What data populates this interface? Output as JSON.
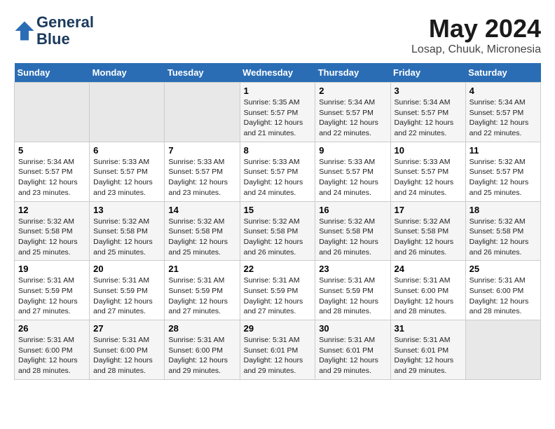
{
  "header": {
    "logo_line1": "General",
    "logo_line2": "Blue",
    "title": "May 2024",
    "subtitle": "Losap, Chuuk, Micronesia"
  },
  "weekdays": [
    "Sunday",
    "Monday",
    "Tuesday",
    "Wednesday",
    "Thursday",
    "Friday",
    "Saturday"
  ],
  "weeks": [
    [
      {
        "day": "",
        "info": ""
      },
      {
        "day": "",
        "info": ""
      },
      {
        "day": "",
        "info": ""
      },
      {
        "day": "1",
        "info": "Sunrise: 5:35 AM\nSunset: 5:57 PM\nDaylight: 12 hours and 21 minutes."
      },
      {
        "day": "2",
        "info": "Sunrise: 5:34 AM\nSunset: 5:57 PM\nDaylight: 12 hours and 22 minutes."
      },
      {
        "day": "3",
        "info": "Sunrise: 5:34 AM\nSunset: 5:57 PM\nDaylight: 12 hours and 22 minutes."
      },
      {
        "day": "4",
        "info": "Sunrise: 5:34 AM\nSunset: 5:57 PM\nDaylight: 12 hours and 22 minutes."
      }
    ],
    [
      {
        "day": "5",
        "info": "Sunrise: 5:34 AM\nSunset: 5:57 PM\nDaylight: 12 hours and 23 minutes."
      },
      {
        "day": "6",
        "info": "Sunrise: 5:33 AM\nSunset: 5:57 PM\nDaylight: 12 hours and 23 minutes."
      },
      {
        "day": "7",
        "info": "Sunrise: 5:33 AM\nSunset: 5:57 PM\nDaylight: 12 hours and 23 minutes."
      },
      {
        "day": "8",
        "info": "Sunrise: 5:33 AM\nSunset: 5:57 PM\nDaylight: 12 hours and 24 minutes."
      },
      {
        "day": "9",
        "info": "Sunrise: 5:33 AM\nSunset: 5:57 PM\nDaylight: 12 hours and 24 minutes."
      },
      {
        "day": "10",
        "info": "Sunrise: 5:33 AM\nSunset: 5:57 PM\nDaylight: 12 hours and 24 minutes."
      },
      {
        "day": "11",
        "info": "Sunrise: 5:32 AM\nSunset: 5:57 PM\nDaylight: 12 hours and 25 minutes."
      }
    ],
    [
      {
        "day": "12",
        "info": "Sunrise: 5:32 AM\nSunset: 5:58 PM\nDaylight: 12 hours and 25 minutes."
      },
      {
        "day": "13",
        "info": "Sunrise: 5:32 AM\nSunset: 5:58 PM\nDaylight: 12 hours and 25 minutes."
      },
      {
        "day": "14",
        "info": "Sunrise: 5:32 AM\nSunset: 5:58 PM\nDaylight: 12 hours and 25 minutes."
      },
      {
        "day": "15",
        "info": "Sunrise: 5:32 AM\nSunset: 5:58 PM\nDaylight: 12 hours and 26 minutes."
      },
      {
        "day": "16",
        "info": "Sunrise: 5:32 AM\nSunset: 5:58 PM\nDaylight: 12 hours and 26 minutes."
      },
      {
        "day": "17",
        "info": "Sunrise: 5:32 AM\nSunset: 5:58 PM\nDaylight: 12 hours and 26 minutes."
      },
      {
        "day": "18",
        "info": "Sunrise: 5:32 AM\nSunset: 5:58 PM\nDaylight: 12 hours and 26 minutes."
      }
    ],
    [
      {
        "day": "19",
        "info": "Sunrise: 5:31 AM\nSunset: 5:59 PM\nDaylight: 12 hours and 27 minutes."
      },
      {
        "day": "20",
        "info": "Sunrise: 5:31 AM\nSunset: 5:59 PM\nDaylight: 12 hours and 27 minutes."
      },
      {
        "day": "21",
        "info": "Sunrise: 5:31 AM\nSunset: 5:59 PM\nDaylight: 12 hours and 27 minutes."
      },
      {
        "day": "22",
        "info": "Sunrise: 5:31 AM\nSunset: 5:59 PM\nDaylight: 12 hours and 27 minutes."
      },
      {
        "day": "23",
        "info": "Sunrise: 5:31 AM\nSunset: 5:59 PM\nDaylight: 12 hours and 28 minutes."
      },
      {
        "day": "24",
        "info": "Sunrise: 5:31 AM\nSunset: 6:00 PM\nDaylight: 12 hours and 28 minutes."
      },
      {
        "day": "25",
        "info": "Sunrise: 5:31 AM\nSunset: 6:00 PM\nDaylight: 12 hours and 28 minutes."
      }
    ],
    [
      {
        "day": "26",
        "info": "Sunrise: 5:31 AM\nSunset: 6:00 PM\nDaylight: 12 hours and 28 minutes."
      },
      {
        "day": "27",
        "info": "Sunrise: 5:31 AM\nSunset: 6:00 PM\nDaylight: 12 hours and 28 minutes."
      },
      {
        "day": "28",
        "info": "Sunrise: 5:31 AM\nSunset: 6:00 PM\nDaylight: 12 hours and 29 minutes."
      },
      {
        "day": "29",
        "info": "Sunrise: 5:31 AM\nSunset: 6:01 PM\nDaylight: 12 hours and 29 minutes."
      },
      {
        "day": "30",
        "info": "Sunrise: 5:31 AM\nSunset: 6:01 PM\nDaylight: 12 hours and 29 minutes."
      },
      {
        "day": "31",
        "info": "Sunrise: 5:31 AM\nSunset: 6:01 PM\nDaylight: 12 hours and 29 minutes."
      },
      {
        "day": "",
        "info": ""
      }
    ]
  ]
}
